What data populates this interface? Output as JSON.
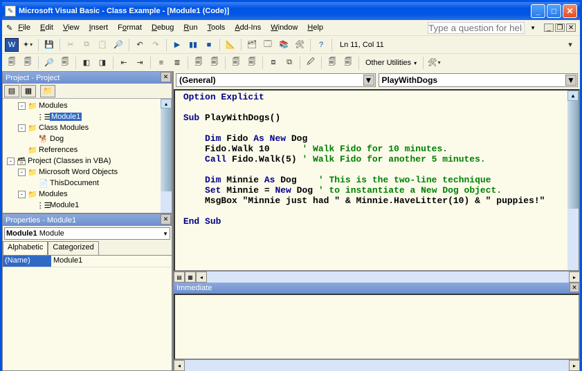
{
  "title": "Microsoft Visual Basic - Class Example - [Module1 (Code)]",
  "menu": [
    "File",
    "Edit",
    "View",
    "Insert",
    "Format",
    "Debug",
    "Run",
    "Tools",
    "Add-Ins",
    "Window",
    "Help"
  ],
  "help_placeholder": "Type a question for help",
  "status_pos": "Ln 11, Col 11",
  "toolbar2_other": "Other Utilities",
  "project_panel": {
    "title": "Project - Project",
    "tree": [
      {
        "indent": 1,
        "type": "folder",
        "toggle": "-",
        "label": "Modules"
      },
      {
        "indent": 2,
        "type": "module",
        "label": "Module1",
        "selected": true
      },
      {
        "indent": 1,
        "type": "folder",
        "toggle": "-",
        "label": "Class Modules"
      },
      {
        "indent": 2,
        "type": "class",
        "label": "Dog"
      },
      {
        "indent": 1,
        "type": "folder",
        "toggle": "",
        "label": "References"
      },
      {
        "indent": 0,
        "type": "project",
        "toggle": "-",
        "label": "Project (Classes in VBA)"
      },
      {
        "indent": 1,
        "type": "folder",
        "toggle": "-",
        "label": "Microsoft Word Objects"
      },
      {
        "indent": 2,
        "type": "doc",
        "label": "ThisDocument"
      },
      {
        "indent": 1,
        "type": "folder",
        "toggle": "-",
        "label": "Modules"
      },
      {
        "indent": 2,
        "type": "module",
        "label": "Module1"
      }
    ]
  },
  "properties_panel": {
    "title": "Properties - Module1",
    "combo_bold": "Module1",
    "combo_rest": "Module",
    "tabs": [
      "Alphabetic",
      "Categorized"
    ],
    "rows": [
      {
        "k": "(Name)",
        "v": "Module1"
      }
    ]
  },
  "code": {
    "object_combo": "(General)",
    "proc_combo": "PlayWithDogs",
    "lines": [
      [
        [
          "kw",
          "Option Explicit"
        ]
      ],
      [
        [
          "",
          ""
        ]
      ],
      [
        [
          "kw",
          "Sub "
        ],
        [
          "",
          "PlayWithDogs()"
        ]
      ],
      [
        [
          "",
          ""
        ]
      ],
      [
        [
          "",
          "    "
        ],
        [
          "kw",
          "Dim "
        ],
        [
          "",
          "Fido "
        ],
        [
          "kw",
          "As New "
        ],
        [
          "",
          "Dog"
        ]
      ],
      [
        [
          "",
          "    Fido.Walk 10      "
        ],
        [
          "cm",
          "' Walk Fido for 10 minutes."
        ]
      ],
      [
        [
          "",
          "    "
        ],
        [
          "kw",
          "Call "
        ],
        [
          "",
          "Fido.Walk(5) "
        ],
        [
          "cm",
          "' Walk Fido for another 5 minutes."
        ]
      ],
      [
        [
          "",
          ""
        ]
      ],
      [
        [
          "",
          "    "
        ],
        [
          "kw",
          "Dim "
        ],
        [
          "",
          "Minnie "
        ],
        [
          "kw",
          "As "
        ],
        [
          "",
          "Dog    "
        ],
        [
          "cm",
          "' This is the two-line technique"
        ]
      ],
      [
        [
          "",
          "    "
        ],
        [
          "kw",
          "Set "
        ],
        [
          "",
          "Minnie = "
        ],
        [
          "kw",
          "New "
        ],
        [
          "",
          "Dog "
        ],
        [
          "cm",
          "' to instantiate a New Dog object."
        ]
      ],
      [
        [
          "",
          "    MsgBox \"Minnie just had \" & Minnie.HaveLitter(10) & \" puppies!\""
        ]
      ],
      [
        [
          "",
          ""
        ]
      ],
      [
        [
          "kw",
          "End Sub"
        ]
      ]
    ]
  },
  "immediate_title": "Immediate"
}
